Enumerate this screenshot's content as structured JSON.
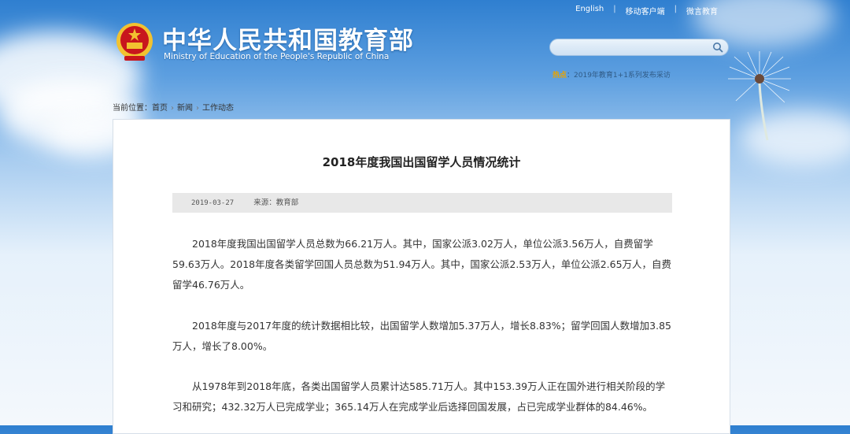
{
  "header": {
    "title_cn": "中华人民共和国教育部",
    "title_en": "Ministry of Education of the People's Republic of China",
    "top_links": [
      "English",
      "移动客户端",
      "微言教育"
    ],
    "search": {
      "value": ""
    },
    "hot_tag": "热点",
    "hot_text": "2019年教育1+1系列发布采访"
  },
  "breadcrumb": {
    "label": "当前位置：",
    "items": [
      "首页",
      "新闻",
      "工作动态"
    ]
  },
  "article": {
    "title": "2018年度我国出国留学人员情况统计",
    "date": "2019-03-27",
    "source": "来源：教育部",
    "paragraphs": [
      "2018年度我国出国留学人员总数为66.21万人。其中，国家公派3.02万人，单位公派3.56万人，自费留学59.63万人。2018年度各类留学回国人员总数为51.94万人。其中，国家公派2.53万人，单位公派2.65万人，自费留学46.76万人。",
      "2018年度与2017年度的统计数据相比较，出国留学人数增加5.37万人，增长8.83%；留学回国人数增加3.85万人，增长了8.00%。",
      "从1978年到2018年底，各类出国留学人员累计达585.71万人。其中153.39万人正在国外进行相关阶段的学习和研究；432.32万人已完成学业；365.14万人在完成学业后选择回国发展，占已完成学业群体的84.46%。"
    ]
  },
  "colors": {
    "emblem_red": "#c8161d",
    "emblem_gold": "#f2c230",
    "hot_tag": "#e8a300"
  }
}
